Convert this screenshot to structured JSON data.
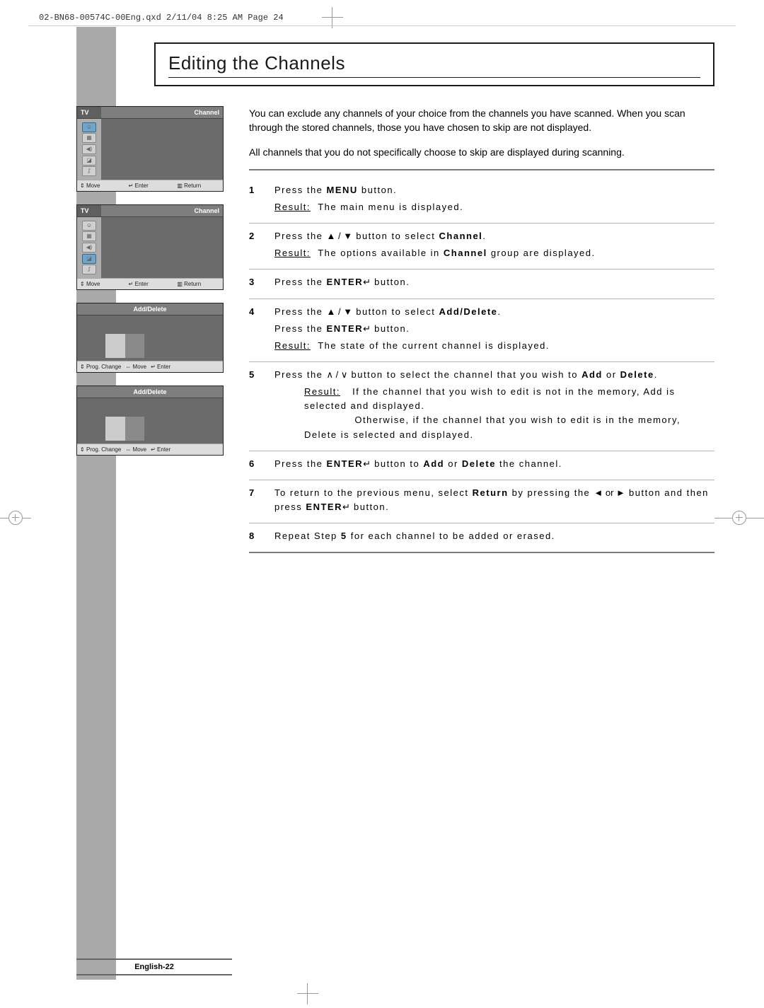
{
  "header": "02-BN68-00574C-00Eng.qxd  2/11/04 8:25 AM  Page 24",
  "title": "Editing the Channels",
  "intro": {
    "p1": "You can exclude any channels of your choice from the channels you have scanned. When you scan through the stored channels, those you have chosen to skip are not displayed.",
    "p2": "All channels that you do not specifically choose to skip are displayed during scanning."
  },
  "menus": {
    "tv_label": "TV",
    "channel_label": "Channel",
    "foot_move": "Move",
    "foot_enter": "Enter",
    "foot_return": "Return",
    "ad_title": "Add/Delete",
    "foot_prog": "Prog. Change"
  },
  "symbols": {
    "updown": "▲ / ▼",
    "skip": "∧ / ∨",
    "lr": "◄ or ►",
    "enter_sym": "↵"
  },
  "labels": {
    "result": "Result:",
    "menu": "MENU",
    "enter": "ENTER",
    "channel": "Channel",
    "add_delete": "Add/Delete",
    "add": "Add",
    "delete": "Delete",
    "return": "Return"
  },
  "steps": {
    "s1": {
      "num": "1",
      "l1a": "Press the ",
      "l1b": " button.",
      "r1": "The main menu is displayed."
    },
    "s2": {
      "num": "2",
      "l1a": "Press the ",
      "l1b": " button to select ",
      "r1": "The options available in ",
      "r2": " group are displayed."
    },
    "s3": {
      "num": "3",
      "l1a": "Press the ",
      "l1b": " button."
    },
    "s4": {
      "num": "4",
      "l1a": "Press the ",
      "l1b": " button to select ",
      "l2a": "Press the ",
      "l2b": " button.",
      "r1": "The state of the current channel is displayed."
    },
    "s5": {
      "num": "5",
      "l1a": "Press the ",
      "l1b": " button to select the channel that you wish to ",
      "l1c": " or ",
      "r1": "If the channel that you wish to edit is not in the memory, Add is selected and displayed.",
      "r2": "Otherwise, if the channel that you wish to edit is in the memory, Delete is selected and displayed."
    },
    "s6": {
      "num": "6",
      "l1a": "Press the ",
      "l1b": " button to ",
      "l1c": " or ",
      "l1d": " the channel."
    },
    "s7": {
      "num": "7",
      "l1a": "To return to the previous menu, select ",
      "l1b": " by pressing the ",
      "l2a": " button and then press ",
      "l2b": " button."
    },
    "s8": {
      "num": "8",
      "l1a": "Repeat Step ",
      "l1b": "5",
      "l1c": " for each channel to be added or erased."
    }
  },
  "footer": "English-22"
}
